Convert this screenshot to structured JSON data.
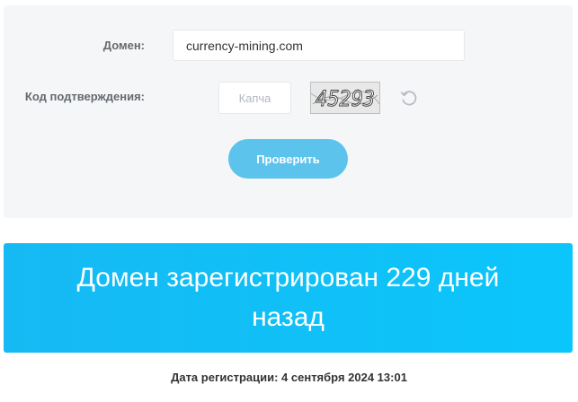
{
  "form": {
    "domain_label": "Домен:",
    "domain_value": "currency-mining.com",
    "code_label": "Код подтверждения:",
    "captcha_placeholder": "Капча",
    "captcha_image_text": "45293",
    "refresh_icon": "refresh-icon",
    "submit_label": "Проверить"
  },
  "result": {
    "message": "Домен зарегистрирован 229 дней назад",
    "registration_date": "Дата регистрации: 4 сентября 2024 13:01"
  },
  "colors": {
    "panel_bg": "#f4f6f8",
    "button_bg": "#5cc3ec",
    "banner_bg": "#16b9f3"
  }
}
